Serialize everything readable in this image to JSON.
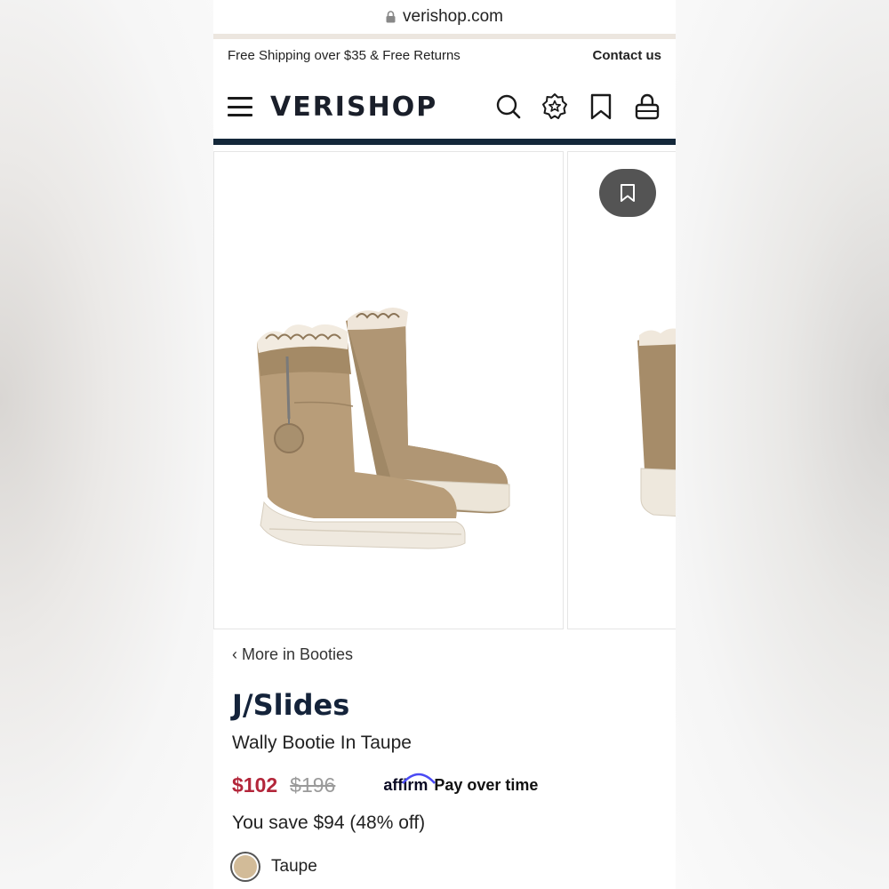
{
  "browser": {
    "url": "verishop.com"
  },
  "promo": {
    "shipping": "Free Shipping over $35 & Free Returns",
    "contact": "Contact us"
  },
  "header": {
    "logo": "VERISHOP",
    "icons": [
      "menu-icon",
      "search-icon",
      "rewards-icon",
      "bookmark-icon",
      "bag-icon"
    ]
  },
  "gallery": {
    "images": [
      "boot-pair-image",
      "boot-side-image"
    ],
    "save_button_icon": "bookmark-icon"
  },
  "product": {
    "back_link": "‹ More in Booties",
    "brand": "J/Slides",
    "name": "Wally Bootie In Taupe",
    "price": "$102",
    "original_price": "$196",
    "financing_brand": "affirm",
    "financing_text": "Pay over time",
    "savings": "You save $94 (48% off)",
    "color": {
      "label": "Taupe",
      "swatch": "#d2bb98"
    }
  },
  "colors": {
    "accent": "#b3263a",
    "nav_bar": "#14283a",
    "brand_text": "#14233a"
  }
}
